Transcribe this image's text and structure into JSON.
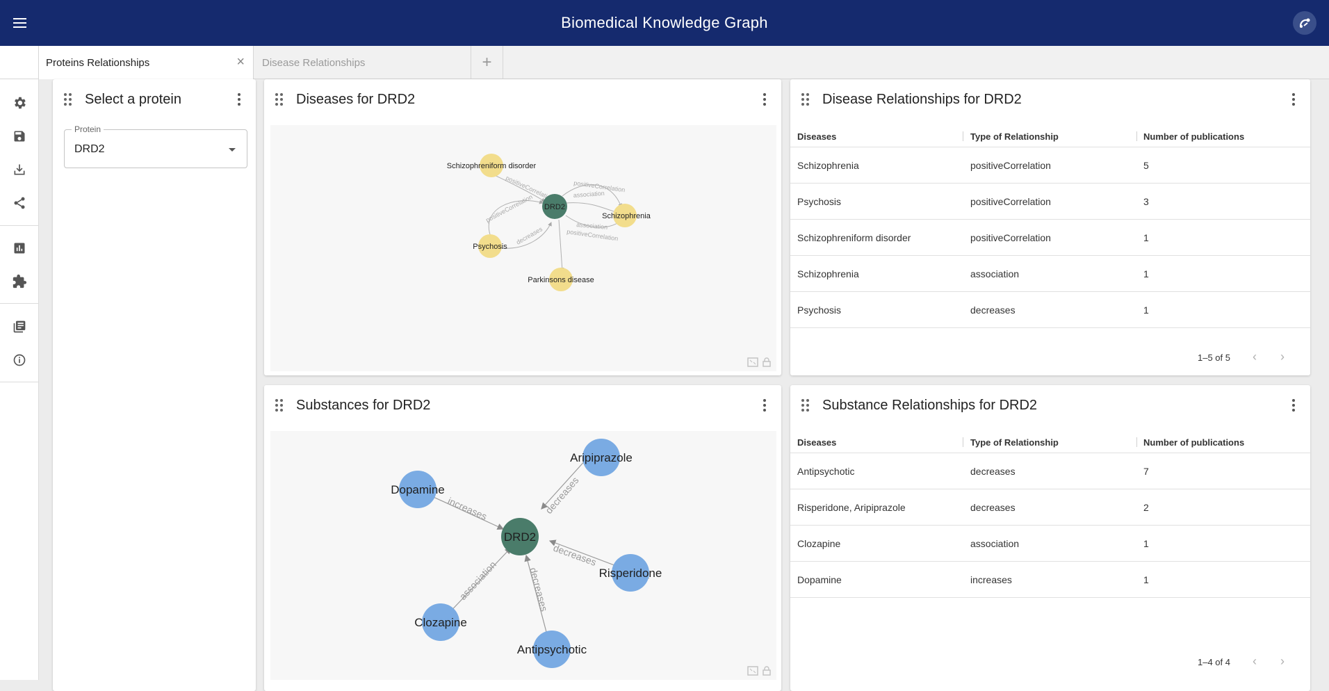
{
  "app": {
    "title": "Biomedical Knowledge Graph"
  },
  "tabs": [
    {
      "label": "Proteins Relationships"
    },
    {
      "label": "Disease Relationships"
    }
  ],
  "tab_add_label": "+",
  "tab_close_glyph": "×",
  "sidebar_icons": [
    "settings-icon",
    "save-icon",
    "download-icon",
    "share-icon",
    "bar-chart-icon",
    "extension-icon",
    "library-icon",
    "info-icon"
  ],
  "select_panel": {
    "title": "Select a protein",
    "field_label": "Protein",
    "field_value": "DRD2"
  },
  "diseases_graph": {
    "title": "Diseases for DRD2",
    "center": "DRD2",
    "nodes": [
      "Schizophreniform disorder",
      "Schizophrenia",
      "Psychosis",
      "Parkinsons disease"
    ],
    "edge_labels": [
      "positiveCorrelation",
      "positiveCorrelation",
      "association",
      "positiveCorrelation",
      "positiveCorrelation",
      "decreases",
      "association"
    ],
    "center_color": "#4a7c6a",
    "node_color": "#f2dd8c"
  },
  "disease_table": {
    "title": "Disease Relationships for DRD2",
    "columns": [
      "Diseases",
      "Type of Relationship",
      "Number of publications"
    ],
    "rows": [
      [
        "Schizophrenia",
        "positiveCorrelation",
        "5"
      ],
      [
        "Psychosis",
        "positiveCorrelation",
        "3"
      ],
      [
        "Schizophreniform disorder",
        "positiveCorrelation",
        "1"
      ],
      [
        "Schizophrenia",
        "association",
        "1"
      ],
      [
        "Psychosis",
        "decreases",
        "1"
      ]
    ],
    "pagination": "1–5 of 5"
  },
  "substances_graph": {
    "title": "Substances for DRD2",
    "center": "DRD2",
    "nodes": [
      "Aripiprazole",
      "Dopamine",
      "Risperidone",
      "Clozapine",
      "Antipsychotic"
    ],
    "edge_labels": [
      "decreases",
      "increases",
      "decreases",
      "association",
      "decreases"
    ],
    "center_color": "#4a7c6a",
    "node_color": "#7aabe3"
  },
  "substance_table": {
    "title": "Substance Relationships for DRD2",
    "columns": [
      "Diseases",
      "Type of Relationship",
      "Number of publications"
    ],
    "rows": [
      [
        "Antipsychotic",
        "decreases",
        "7"
      ],
      [
        "Risperidone, Aripiprazole",
        "decreases",
        "2"
      ],
      [
        "Clozapine",
        "association",
        "1"
      ],
      [
        "Dopamine",
        "increases",
        "1"
      ]
    ],
    "pagination": "1–4 of 4"
  },
  "pager_prev": "‹",
  "pager_next": "›"
}
